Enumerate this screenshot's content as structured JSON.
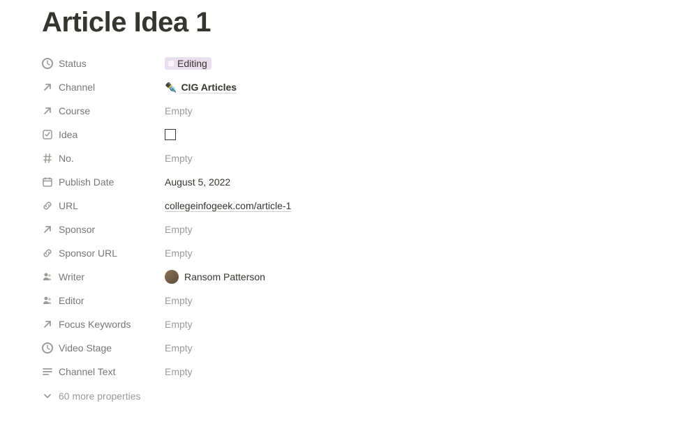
{
  "title": "Article Idea 1",
  "properties": {
    "status": {
      "label": "Status",
      "value": "Editing"
    },
    "channel": {
      "label": "Channel",
      "emoji": "✒️",
      "value": "CIG Articles"
    },
    "course": {
      "label": "Course",
      "value": "Empty"
    },
    "idea": {
      "label": "Idea"
    },
    "no": {
      "label": "No.",
      "value": "Empty"
    },
    "publish_date": {
      "label": "Publish Date",
      "value": "August 5, 2022"
    },
    "url": {
      "label": "URL",
      "value": "collegeinfogeek.com/article-1"
    },
    "sponsor": {
      "label": "Sponsor",
      "value": "Empty"
    },
    "sponsor_url": {
      "label": "Sponsor URL",
      "value": "Empty"
    },
    "writer": {
      "label": "Writer",
      "value": "Ransom Patterson"
    },
    "editor": {
      "label": "Editor",
      "value": "Empty"
    },
    "focus_keywords": {
      "label": "Focus Keywords",
      "value": "Empty"
    },
    "video_stage": {
      "label": "Video Stage",
      "value": "Empty"
    },
    "channel_text": {
      "label": "Channel Text",
      "value": "Empty"
    }
  },
  "more_properties": "60 more properties"
}
